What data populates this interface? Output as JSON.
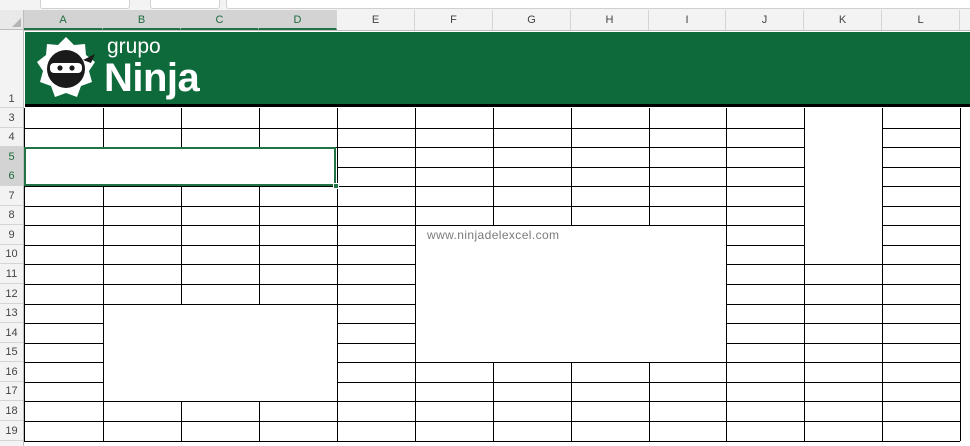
{
  "columns": [
    "A",
    "B",
    "C",
    "D",
    "E",
    "F",
    "G",
    "H",
    "I",
    "J",
    "K",
    "L"
  ],
  "rows": [
    "1",
    "3",
    "4",
    "5",
    "6",
    "7",
    "8",
    "9",
    "10",
    "11",
    "12",
    "13",
    "14",
    "15",
    "16",
    "17",
    "18",
    "19"
  ],
  "selected_columns": [
    "A",
    "B",
    "C",
    "D"
  ],
  "selected_rows": [
    "5",
    "6"
  ],
  "banner": {
    "grupo": "grupo",
    "ninja": "Ninja",
    "color": "#0e6a3b"
  },
  "watermark": "www.ninjadelexcel.com",
  "colors": {
    "accent": "#217346",
    "header_bg": "#f3f3f3",
    "gridline": "#000000"
  }
}
